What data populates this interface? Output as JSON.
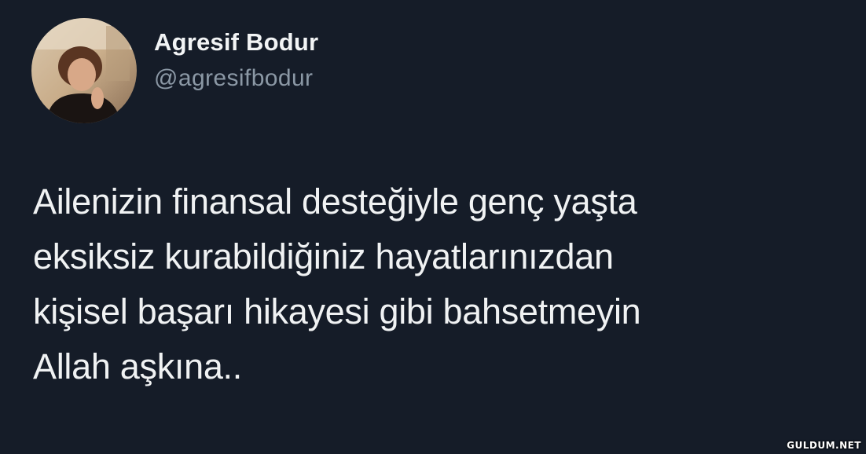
{
  "user": {
    "display_name": "Agresif Bodur",
    "handle": "@agresifbodur"
  },
  "tweet": {
    "lines": [
      "Ailenizin finansal desteğiyle genç yaşta",
      "eksiksiz kurabildiğiniz hayatlarınızdan",
      "kişisel başarı hikayesi gibi bahsetmeyin",
      "Allah aşkına.."
    ]
  },
  "watermark": "GULDUM.NET",
  "colors": {
    "background": "#151c28",
    "text": "#f0f2f3",
    "secondary_text": "#8b98a5"
  }
}
